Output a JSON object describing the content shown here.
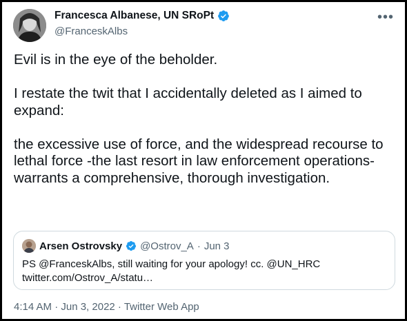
{
  "author": {
    "display_name": "Francesca Albanese, UN SRoPt",
    "handle": "@FranceskAlbs"
  },
  "tweet": {
    "paragraphs": [
      "Evil is in the eye of the beholder.",
      "I restate the twit that I accidentally deleted as I aimed to expand:",
      "the excessive use of force, and the widespread recourse to lethal force -the last resort in law enforcement operations- warrants a comprehensive, thorough investigation."
    ]
  },
  "quoted": {
    "display_name": "Arsen Ostrovsky",
    "handle": "@Ostrov_A",
    "separator": "·",
    "date": "Jun 3",
    "text_line1": "PS @FranceskAlbs, still waiting for your apology! cc. @UN_HRC",
    "text_line2": "twitter.com/Ostrov_A/statu…"
  },
  "footer": {
    "timestamp": "4:14 AM · Jun 3, 2022 · Twitter Web App"
  },
  "icons": {
    "verified": "verified-badge-icon",
    "more": "more-options-icon"
  },
  "colors": {
    "verified_blue": "#1d9bf0",
    "text_primary": "#0f1419",
    "text_secondary": "#536471",
    "border": "#cfd9de"
  }
}
